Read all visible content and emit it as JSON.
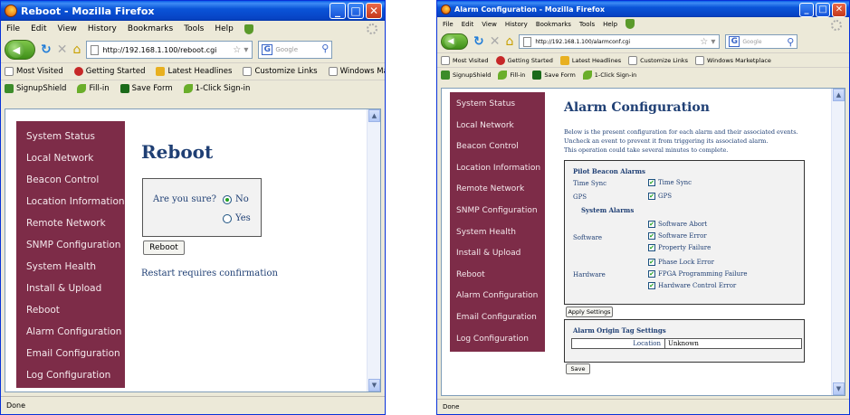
{
  "window1": {
    "title": "Reboot - Mozilla Firefox",
    "menu": [
      "File",
      "Edit",
      "View",
      "History",
      "Bookmarks",
      "Tools",
      "Help"
    ],
    "url": "http://192.168.1.100/reboot.cgi",
    "search_placeholder": "Google",
    "bookmarks": [
      "Most Visited",
      "Getting Started",
      "Latest Headlines",
      "Customize Links",
      "Windows Marketplace"
    ],
    "toolbar2": [
      "SignupShield",
      "Fill-in",
      "Save Form",
      "1-Click Sign-in"
    ],
    "status": "Done",
    "page": {
      "heading": "Reboot",
      "question": "Are you sure?",
      "option_no": "No",
      "option_yes": "Yes",
      "button": "Reboot",
      "note": "Restart requires confirmation"
    }
  },
  "window2": {
    "title": "Alarm Configuration - Mozilla Firefox",
    "menu": [
      "File",
      "Edit",
      "View",
      "History",
      "Bookmarks",
      "Tools",
      "Help"
    ],
    "url": "http://192.168.1.100/alarmconf.cgi",
    "search_placeholder": "Google",
    "bookmarks": [
      "Most Visited",
      "Getting Started",
      "Latest Headlines",
      "Customize Links",
      "Windows Marketplace"
    ],
    "toolbar2": [
      "SignupShield",
      "Fill-in",
      "Save Form",
      "1-Click Sign-in"
    ],
    "status": "Done",
    "page": {
      "heading": "Alarm Configuration",
      "intro": [
        "Below is the present configuration for each alarm and their associated events.",
        "Uncheck an event to prevent it from triggering its associated alarm.",
        "This operation could take several minutes to complete."
      ],
      "pilot_heading": "Pilot Beacon Alarms",
      "system_heading": "System Alarms",
      "time_sync_label": "Time Sync",
      "time_sync_event": "Time Sync",
      "gps_label": "GPS",
      "gps_event": "GPS",
      "software_label": "Software",
      "software_events": [
        "Software Abort",
        "Software Error",
        "Property Failure"
      ],
      "hardware_label": "Hardware",
      "hardware_events": [
        "Phase Lock Error",
        "FPGA Programming Failure",
        "Hardware Control Error"
      ],
      "apply_button": "Apply Settings",
      "origin_heading": "Alarm Origin Tag Settings",
      "location_label": "Location",
      "location_value": "Unknown",
      "save_button": "Save"
    }
  },
  "sidebar": [
    "System Status",
    "Local Network",
    "Beacon Control",
    "Location Information",
    "Remote Network",
    "SNMP Configuration",
    "System Health",
    "Install & Upload",
    "Reboot",
    "Alarm Configuration",
    "Email Configuration",
    "Log Configuration"
  ],
  "colors": {
    "sidebar": "#7d2c48",
    "heading": "#1f3f74",
    "titlebar": "#0a54d8",
    "check": "#21a121"
  }
}
